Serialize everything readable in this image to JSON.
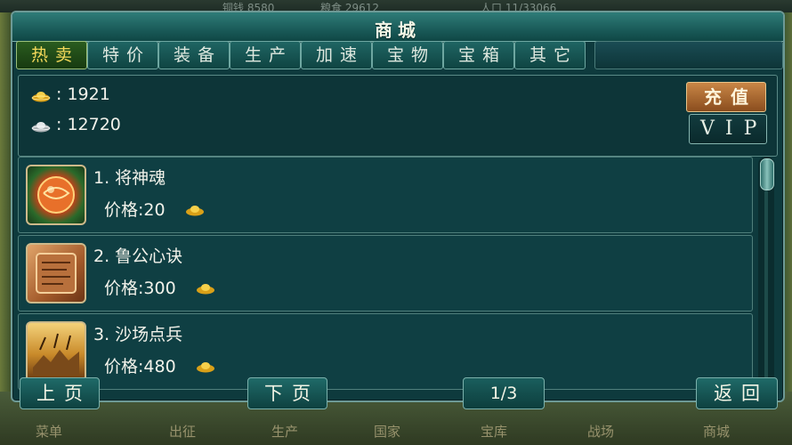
{
  "background": {
    "top_resources": [
      "铜钱 8580",
      "粮食 29612",
      "人口 11/33066"
    ],
    "bottom_nav": [
      "菜单",
      "出征",
      "生产",
      "国家",
      "宝库",
      "战场",
      "商城"
    ]
  },
  "shop": {
    "title": "商城",
    "tabs": [
      "热卖",
      "特价",
      "装备",
      "生产",
      "加速",
      "宝物",
      "宝箱",
      "其它"
    ],
    "active_tab": 0,
    "gold": ": 1921",
    "silver": ": 12720",
    "recharge_label": "充值",
    "vip_label": "VIP",
    "items": [
      {
        "name": "1. 将神魂",
        "price": "价格:20",
        "icon": "orb-icon"
      },
      {
        "name": "2. 鲁公心诀",
        "price": "价格:300",
        "icon": "scroll-icon"
      },
      {
        "name": "3. 沙场点兵",
        "price": "价格:480",
        "icon": "battle-icon"
      }
    ],
    "prev_label": "上页",
    "next_label": "下页",
    "page_indicator": "1/3",
    "back_label": "返回"
  },
  "colors": {
    "panel": "#0e3a3d",
    "active_tab_text": "#f3d85a",
    "gold": "#f0c030",
    "recharge_button": "#b06a30"
  }
}
